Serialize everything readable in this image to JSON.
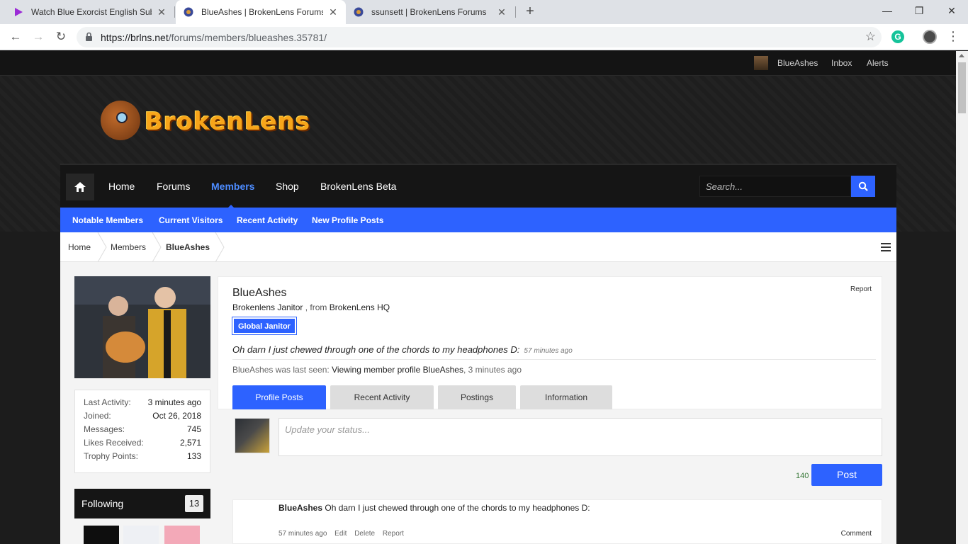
{
  "browser": {
    "tabs": [
      {
        "title": "Watch Blue Exorcist English Subb",
        "active": false
      },
      {
        "title": "BlueAshes | BrokenLens Forums",
        "active": true
      },
      {
        "title": "ssunsett | BrokenLens Forums",
        "active": false
      }
    ],
    "url_host": "https://brlns.net",
    "url_path": "/forums/members/blueashes.35781/",
    "window_controls": {
      "minimize": "—",
      "maximize": "❐",
      "close": "✕"
    }
  },
  "topbar": {
    "username": "BlueAshes",
    "inbox": "Inbox",
    "alerts": "Alerts"
  },
  "logo": {
    "text": "BrokenLens"
  },
  "nav": {
    "items": [
      "Home",
      "Forums",
      "Members",
      "Shop",
      "BrokenLens Beta"
    ],
    "active": "Members",
    "search_placeholder": "Search..."
  },
  "subnav": [
    "Notable Members",
    "Current Visitors",
    "Recent Activity",
    "New Profile Posts"
  ],
  "breadcrumbs": [
    "Home",
    "Members",
    "BlueAshes"
  ],
  "profile": {
    "name": "BlueAshes",
    "title": "Brokenlens Janitor",
    "from_label": ", from",
    "location": "BrokenLens HQ",
    "badge": "Global Janitor",
    "report": "Report",
    "status": "Oh darn I just chewed through one of the chords to my headphones D:",
    "status_time": "57 minutes ago",
    "last_seen_prefix": "BlueAshes was last seen:",
    "last_seen_activity": "Viewing member profile BlueAshes",
    "last_seen_time": ", 3 minutes ago",
    "tabs": [
      "Profile Posts",
      "Recent Activity",
      "Postings",
      "Information"
    ]
  },
  "stats": [
    {
      "label": "Last Activity:",
      "value": "3 minutes ago"
    },
    {
      "label": "Joined:",
      "value": "Oct 26, 2018"
    },
    {
      "label": "Messages:",
      "value": "745"
    },
    {
      "label": "Likes Received:",
      "value": "2,571"
    },
    {
      "label": "Trophy Points:",
      "value": "133"
    }
  ],
  "following": {
    "label": "Following",
    "count": "13"
  },
  "composer": {
    "placeholder": "Update your status...",
    "counter": "140",
    "post_label": "Post"
  },
  "post": {
    "author": "BlueAshes",
    "text": "Oh darn I just chewed through one of the chords to my headphones D:",
    "time": "57 minutes ago",
    "edit": "Edit",
    "delete": "Delete",
    "report": "Report",
    "comment": "Comment"
  },
  "colors": {
    "accent": "#2d62ff",
    "header_bg": "#151515"
  }
}
